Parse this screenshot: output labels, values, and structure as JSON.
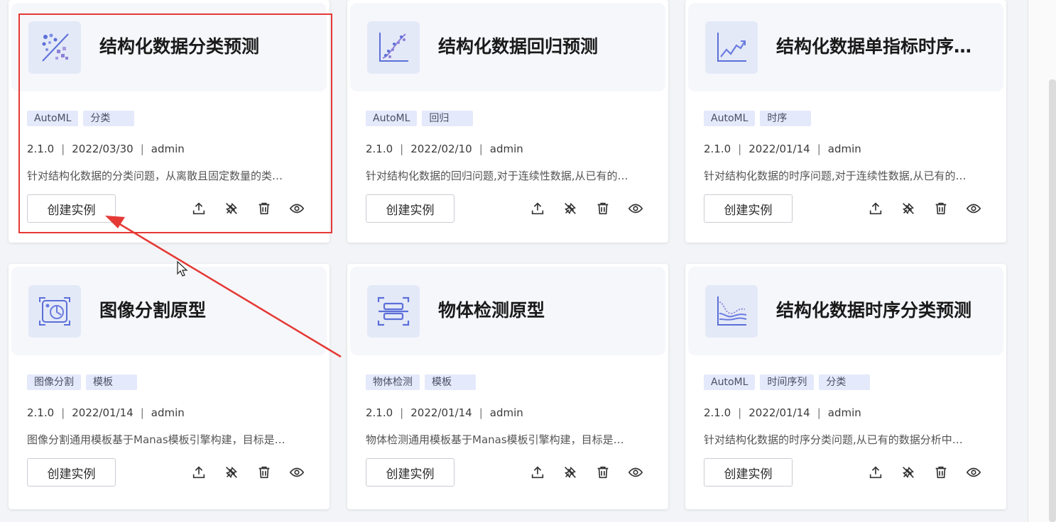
{
  "cards": [
    {
      "title": "结构化数据分类预测",
      "icon": "classification-scatter-icon",
      "tags": [
        "AutoML",
        "分类"
      ],
      "version": "2.1.0",
      "date": "2022/03/30",
      "author": "admin",
      "description": "针对结构化数据的分类问题，从离散且固定数量的类…",
      "create_label": "创建实例"
    },
    {
      "title": "结构化数据回归预测",
      "icon": "regression-scatter-icon",
      "tags": [
        "AutoML",
        "回归"
      ],
      "version": "2.1.0",
      "date": "2022/02/10",
      "author": "admin",
      "description": "针对结构化数据的回归问题,对于连续性数据,从已有的…",
      "create_label": "创建实例"
    },
    {
      "title": "结构化数据单指标时序…",
      "icon": "timeseries-line-icon",
      "tags": [
        "AutoML",
        "时序"
      ],
      "version": "2.1.0",
      "date": "2022/01/14",
      "author": "admin",
      "description": "针对结构化数据的时序问题,对于连续性数据,从已有的…",
      "create_label": "创建实例"
    },
    {
      "title": "图像分割原型",
      "icon": "image-segmentation-icon",
      "tags": [
        "图像分割",
        "模板"
      ],
      "version": "2.1.0",
      "date": "2022/01/14",
      "author": "admin",
      "description": "图像分割通用模板基于Manas模板引擎构建，目标是…",
      "create_label": "创建实例"
    },
    {
      "title": "物体检测原型",
      "icon": "object-detection-icon",
      "tags": [
        "物体检测",
        "模板"
      ],
      "version": "2.1.0",
      "date": "2022/01/14",
      "author": "admin",
      "description": "物体检测通用模板基于Manas模板引擎构建，目标是…",
      "create_label": "创建实例"
    },
    {
      "title": "结构化数据时序分类预测",
      "icon": "timeseries-area-icon",
      "tags": [
        "AutoML",
        "时间序列",
        "分类"
      ],
      "version": "2.1.0",
      "date": "2022/01/14",
      "author": "admin",
      "description": "针对结构化数据的时序分类问题,从已有的数据分析中…",
      "create_label": "创建实例"
    }
  ],
  "actions": [
    "upload-icon",
    "unpin-icon",
    "delete-icon",
    "view-icon"
  ],
  "colors": {
    "highlight": "#e53935",
    "tag_bg": "#e4e9fb",
    "icon_accent": "#5b6fd8"
  }
}
